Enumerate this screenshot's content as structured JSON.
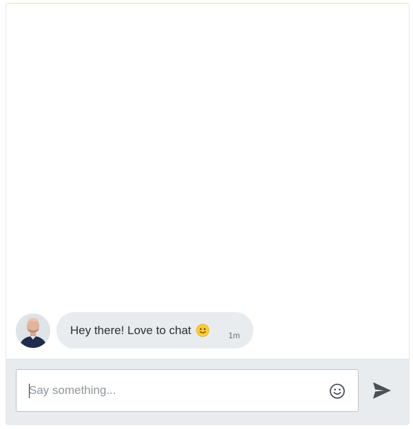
{
  "conversation": {
    "messages": [
      {
        "sender": "agent",
        "text": "Hey there! Love to chat",
        "emoji_icon": "slightly-smiling-face-icon",
        "time": "1m"
      }
    ]
  },
  "composer": {
    "placeholder": "Say something...",
    "value": "",
    "emoji_icon": "smiley-outline-icon",
    "send_icon": "paper-plane-send-icon"
  },
  "colors": {
    "bubble_bg": "#e8ecef",
    "composer_bg": "#e8ecef",
    "text": "#2b2f33",
    "timestamp": "#6b7178",
    "emoji_yellow": "#ffcc33",
    "icon": "#4a5056"
  }
}
